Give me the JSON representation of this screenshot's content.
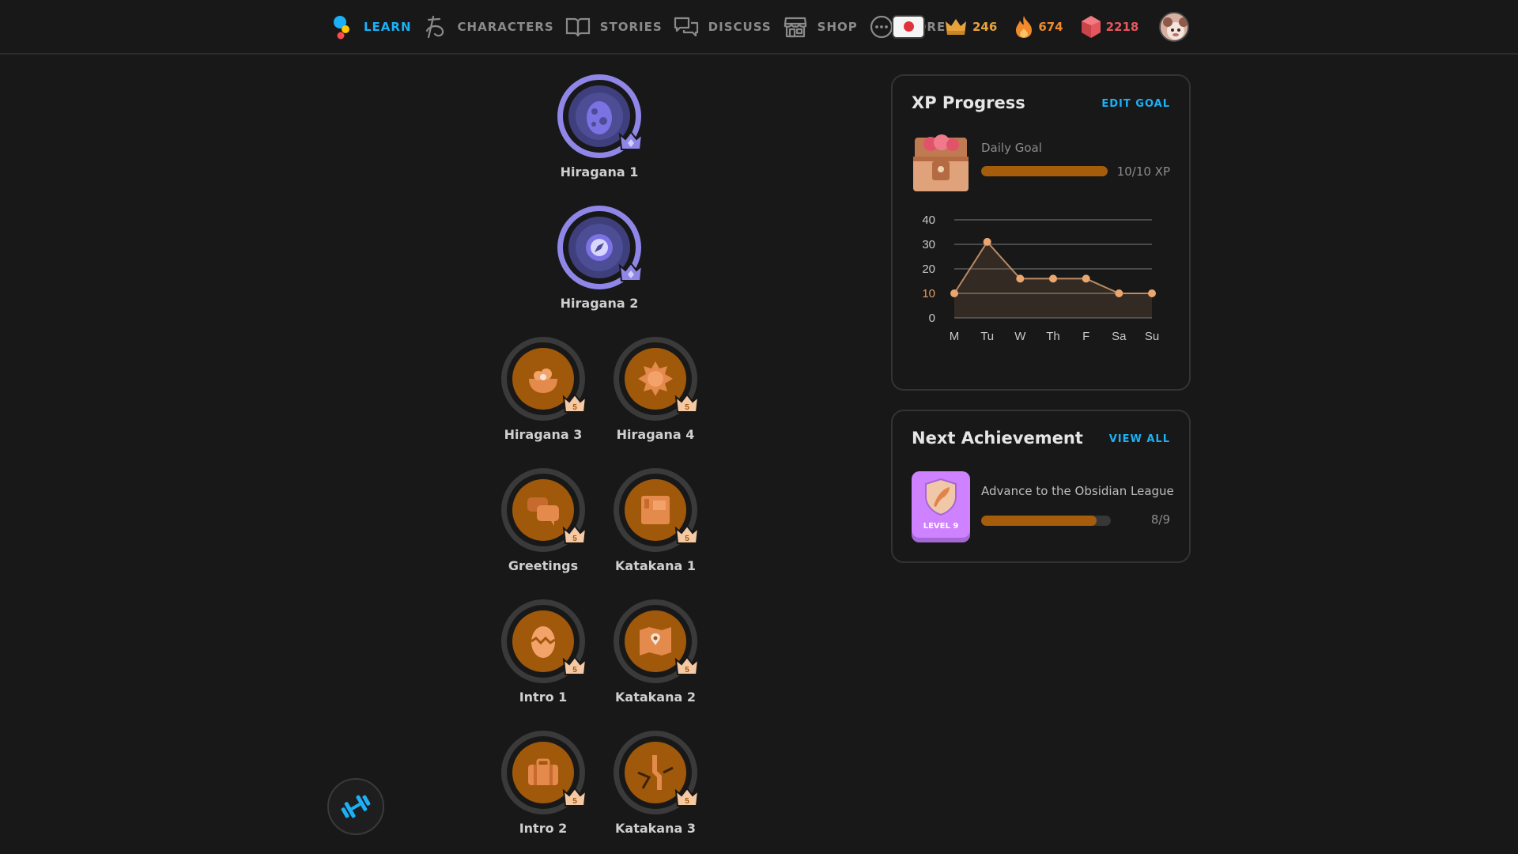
{
  "nav": {
    "items": [
      {
        "label": "LEARN",
        "icon": "learn-icon"
      },
      {
        "label": "CHARACTERS",
        "icon": "characters-icon"
      },
      {
        "label": "STORIES",
        "icon": "book-icon"
      },
      {
        "label": "DISCUSS",
        "icon": "speech-bubbles-icon"
      },
      {
        "label": "SHOP",
        "icon": "shop-icon"
      },
      {
        "label": "MORE",
        "icon": "more-icon"
      }
    ],
    "active": "LEARN"
  },
  "stats": {
    "language_flag": "japan-flag-icon",
    "crowns": "246",
    "streak": "674",
    "gems": "2218"
  },
  "colors": {
    "accent": "#1cb0f6",
    "crowns": "#e8a33c",
    "streak": "#f08a2a",
    "gems": "#e6565e",
    "legendary_ring": "#8f86e8",
    "skill_gold": "#a0580a"
  },
  "skills": [
    {
      "name": "Hiragana 1",
      "status": "legendary",
      "icon": "egg-icon"
    },
    {
      "name": "Hiragana 2",
      "status": "legendary",
      "icon": "compass-icon"
    },
    {
      "name": "Hiragana 3",
      "status": "level 5",
      "crown_level": "5",
      "icon": "food-bowl-icon"
    },
    {
      "name": "Hiragana 4",
      "status": "level 5",
      "crown_level": "5",
      "icon": "sun-icon"
    },
    {
      "name": "Greetings",
      "status": "level 5",
      "crown_level": "5",
      "icon": "chat-icon"
    },
    {
      "name": "Katakana 1",
      "status": "level 5",
      "crown_level": "5",
      "icon": "notebook-icon"
    },
    {
      "name": "Intro 1",
      "status": "level 5",
      "crown_level": "5",
      "icon": "cracked-egg-icon"
    },
    {
      "name": "Katakana 2",
      "status": "level 5",
      "crown_level": "5",
      "icon": "map-icon"
    },
    {
      "name": "Intro 2",
      "status": "level 5",
      "crown_level": "5",
      "icon": "suitcase-icon"
    },
    {
      "name": "Katakana 3",
      "status": "level 5",
      "crown_level": "5",
      "icon": "broken-path-icon"
    }
  ],
  "xp_card": {
    "title": "XP Progress",
    "edit_label": "EDIT GOAL",
    "daily_goal_label": "Daily Goal",
    "progress_text": "10/10 XP",
    "progress_fraction": 1.0
  },
  "chart_data": {
    "type": "area",
    "x": [
      "M",
      "Tu",
      "W",
      "Th",
      "F",
      "Sa",
      "Su"
    ],
    "values": [
      10,
      31,
      16,
      16,
      16,
      10,
      10
    ],
    "yticks": [
      0,
      10,
      20,
      30,
      40
    ],
    "ylim": [
      0,
      40
    ],
    "highlight_tick": 10,
    "grid": true,
    "title": "",
    "xlabel": "",
    "ylabel": ""
  },
  "achievement_card": {
    "title": "Next Achievement",
    "view_all_label": "VIEW ALL",
    "badge_label": "LEVEL 9",
    "description": "Advance to the Obsidian League",
    "progress_text": "8/9",
    "progress_fraction": 0.889
  },
  "fab": {
    "icon": "practice-weights-icon"
  }
}
